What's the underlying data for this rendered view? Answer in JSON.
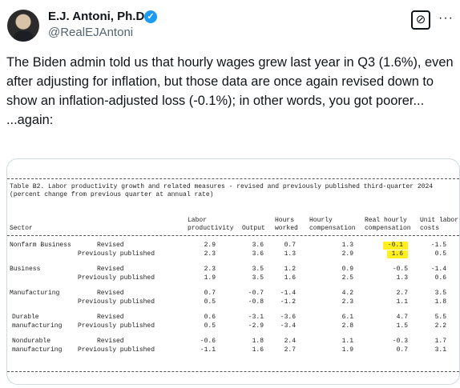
{
  "author": {
    "name": "E.J. Antoni, Ph.D.",
    "handle": "@RealEJAntoni",
    "verified_icon": "✓"
  },
  "actions": {
    "grok_icon": "⊘",
    "more_icon": "···"
  },
  "tweet": {
    "text": "The Biden admin told us that hourly wages grew last year in Q3 (1.6%), even after adjusting for inflation, but those data are once again revised down to show an inflation-adjusted loss (-0.1%); in other words, you got poorer...\n...again:"
  },
  "table": {
    "title": "Table B2. Labor productivity growth and related measures - revised and previously published third-quarter 2024",
    "subtitle": "(percent change from previous quarter at annual rate)",
    "headers": {
      "sector": "Sector",
      "labor_productivity": [
        "Labor",
        "productivity"
      ],
      "output": "Output",
      "hours_worked": [
        "Hours",
        "worked"
      ],
      "hourly_compensation": [
        "Hourly",
        "compensation"
      ],
      "real_hourly_compensation": [
        "Real hourly",
        "compensation"
      ],
      "unit_labor_costs": [
        "Unit labor",
        "costs"
      ]
    },
    "rows": [
      {
        "sector": [
          "Nonfarm Business"
        ],
        "labels": [
          "Revised",
          "Previously published"
        ],
        "values": [
          [
            "2.9",
            "3.6",
            "0.7",
            "1.3",
            "-0.1",
            "-1.5"
          ],
          [
            "2.3",
            "3.6",
            "1.3",
            "2.9",
            "1.6",
            "0.5"
          ]
        ]
      },
      {
        "sector": [
          "Business"
        ],
        "labels": [
          "Revised",
          "Previously published"
        ],
        "values": [
          [
            "2.3",
            "3.5",
            "1.2",
            "0.9",
            "-0.5",
            "-1.4"
          ],
          [
            "1.9",
            "3.5",
            "1.6",
            "2.5",
            "1.3",
            "0.6"
          ]
        ]
      },
      {
        "sector": [
          "Manufacturing"
        ],
        "labels": [
          "Revised",
          "Previously published"
        ],
        "values": [
          [
            "0.7",
            "-0.7",
            "-1.4",
            "4.2",
            "2.7",
            "3.5"
          ],
          [
            "0.5",
            "-0.8",
            "-1.2",
            "2.3",
            "1.1",
            "1.8"
          ]
        ]
      },
      {
        "sector": [
          "Durable",
          "manufacturing"
        ],
        "labels": [
          "Revised",
          "Previously published"
        ],
        "values": [
          [
            "0.6",
            "-3.1",
            "-3.6",
            "6.1",
            "4.7",
            "5.5"
          ],
          [
            "0.5",
            "-2.9",
            "-3.4",
            "2.8",
            "1.5",
            "2.2"
          ]
        ]
      },
      {
        "sector": [
          "Nondurable",
          "manufacturing"
        ],
        "labels": [
          "Revised",
          "Previously published"
        ],
        "values": [
          [
            "-0.6",
            "1.8",
            "2.4",
            "1.1",
            "-0.3",
            "1.7"
          ],
          [
            "-1.1",
            "1.6",
            "2.7",
            "1.9",
            "0.7",
            "3.1"
          ]
        ]
      }
    ],
    "highlight_color": "#ffef1e"
  }
}
